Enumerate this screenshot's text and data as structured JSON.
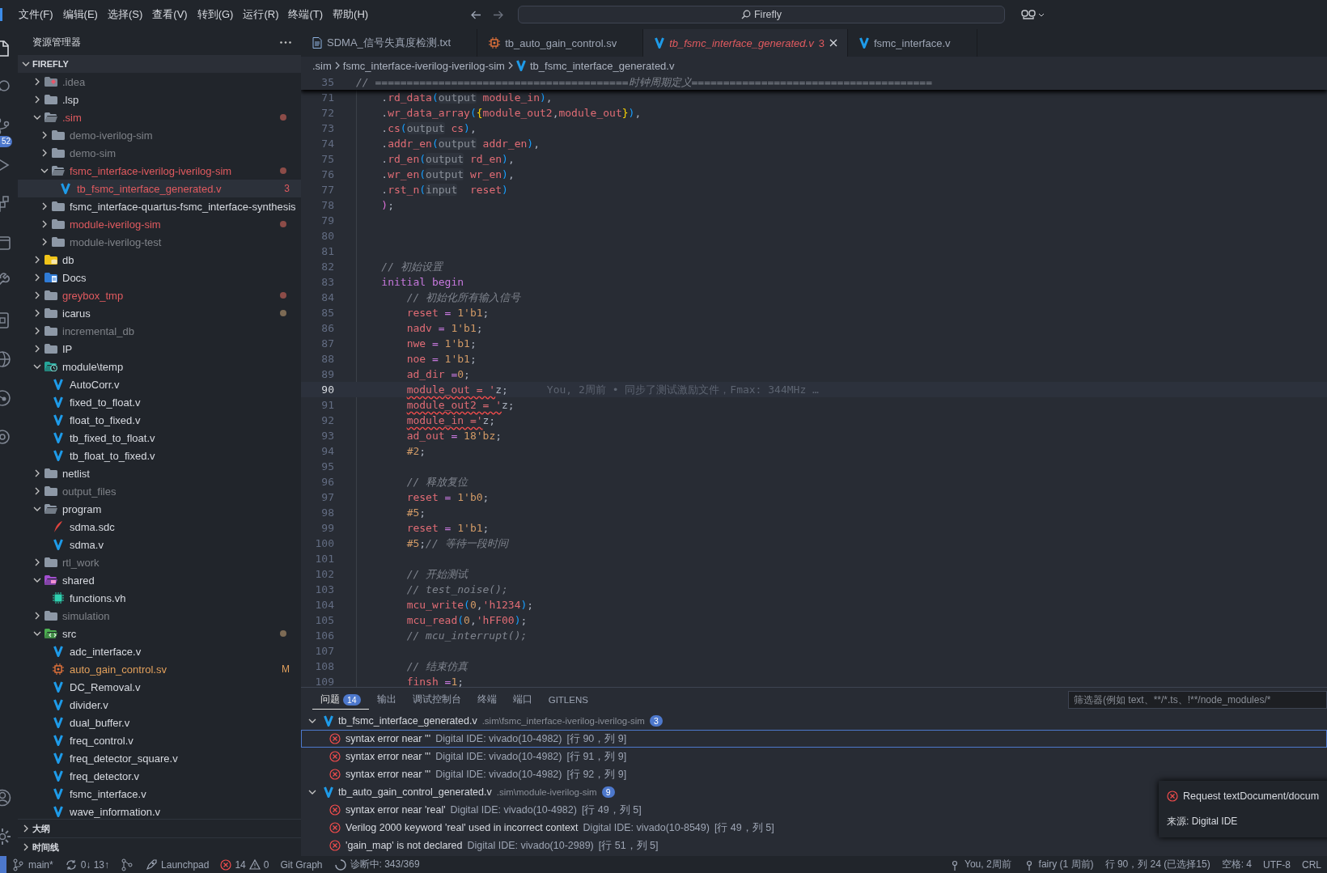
{
  "title_bar": {
    "menus": [
      "文件(F)",
      "编辑(E)",
      "选择(S)",
      "查看(V)",
      "转到(G)",
      "运行(R)",
      "终端(T)",
      "帮助(H)"
    ],
    "search": "Firefly"
  },
  "activity_bar": {
    "items": [
      {
        "kind": "explorer",
        "selected": true
      },
      {
        "kind": "search",
        "selected": false
      },
      {
        "kind": "source-control",
        "selected": false,
        "badge": "52"
      },
      {
        "kind": "run",
        "selected": false
      },
      {
        "kind": "extensions",
        "selected": false
      },
      {
        "kind": "window",
        "selected": false
      },
      {
        "kind": "tools",
        "selected": false
      },
      {
        "kind": "device",
        "selected": false
      },
      {
        "kind": "globe",
        "selected": false
      },
      {
        "kind": "graph",
        "selected": false
      },
      {
        "kind": "box",
        "selected": false
      }
    ],
    "bottom": [
      {
        "kind": "account",
        "selected": false
      },
      {
        "kind": "settings",
        "selected": false
      }
    ]
  },
  "explorer": {
    "title": "资源管理器",
    "root": "FIREFLY",
    "root_expanded": true,
    "tree": [
      {
        "name": ".idea",
        "kind": "idea",
        "ignored": true,
        "errors": false,
        "modified": false,
        "expanded": false,
        "selected": false
      },
      {
        "name": ".lsp",
        "kind": "folder",
        "ignored": false,
        "errors": false,
        "modified": false,
        "expanded": false,
        "selected": false
      },
      {
        "name": ".sim",
        "kind": "folder",
        "ignored": false,
        "errors": true,
        "modified": false,
        "expanded": true,
        "selected": false,
        "color": "#8c4c48",
        "children": [
          {
            "name": "demo-iverilog-sim",
            "kind": "folder",
            "ignored": true,
            "errors": false,
            "modified": false,
            "expanded": false,
            "selected": false
          },
          {
            "name": "demo-sim",
            "kind": "folder",
            "ignored": true,
            "errors": false,
            "modified": false,
            "expanded": false,
            "selected": false
          },
          {
            "name": "fsmc_interface-iverilog-iverilog-sim",
            "kind": "folder",
            "ignored": false,
            "errors": true,
            "modified": false,
            "expanded": true,
            "selected": false,
            "color": "#8c4c48",
            "children": [
              {
                "name": "tb_fsmc_interface_generated.v",
                "kind": "verilog",
                "ignored": false,
                "errors": true,
                "modified": false,
                "selected": true,
                "badge": "3"
              }
            ]
          },
          {
            "name": "fsmc_interface-quartus-fsmc_interface-synthesis",
            "kind": "folder",
            "ignored": false,
            "errors": false,
            "modified": false,
            "expanded": false,
            "selected": false
          },
          {
            "name": "module-iverilog-sim",
            "kind": "folder",
            "ignored": false,
            "errors": true,
            "modified": false,
            "expanded": false,
            "selected": false,
            "color": "#8c4c48"
          },
          {
            "name": "module-iverilog-test",
            "kind": "folder",
            "ignored": true,
            "errors": false,
            "modified": false,
            "expanded": false,
            "selected": false
          }
        ]
      },
      {
        "name": "db",
        "kind": "db",
        "ignored": false,
        "errors": false,
        "modified": false,
        "expanded": false,
        "selected": false
      },
      {
        "name": "Docs",
        "kind": "docs",
        "ignored": false,
        "errors": false,
        "modified": false,
        "expanded": false,
        "selected": false
      },
      {
        "name": "greybox_tmp",
        "kind": "folder",
        "ignored": false,
        "errors": true,
        "modified": false,
        "expanded": false,
        "selected": false,
        "color": "#8c4c48"
      },
      {
        "name": "icarus",
        "kind": "folder",
        "ignored": false,
        "errors": false,
        "modified": false,
        "expanded": false,
        "selected": false,
        "color": "#7d6b55"
      },
      {
        "name": "incremental_db",
        "kind": "folder",
        "ignored": true,
        "errors": false,
        "modified": false,
        "expanded": false,
        "selected": false
      },
      {
        "name": "IP",
        "kind": "folder",
        "ignored": false,
        "errors": false,
        "modified": false,
        "expanded": false,
        "selected": false
      },
      {
        "name": "module\\temp",
        "kind": "clock",
        "ignored": false,
        "errors": false,
        "modified": false,
        "expanded": true,
        "selected": false,
        "children": [
          {
            "name": "AutoCorr.v",
            "kind": "verilog",
            "ignored": false,
            "errors": false,
            "modified": false,
            "selected": false
          },
          {
            "name": "fixed_to_float.v",
            "kind": "verilog",
            "ignored": false,
            "errors": false,
            "modified": false,
            "selected": false
          },
          {
            "name": "float_to_fixed.v",
            "kind": "verilog",
            "ignored": false,
            "errors": false,
            "modified": false,
            "selected": false
          },
          {
            "name": "tb_fixed_to_float.v",
            "kind": "verilog",
            "ignored": false,
            "errors": false,
            "modified": false,
            "selected": false
          },
          {
            "name": "tb_float_to_fixed.v",
            "kind": "verilog",
            "ignored": false,
            "errors": false,
            "modified": false,
            "selected": false
          }
        ]
      },
      {
        "name": "netlist",
        "kind": "folder",
        "ignored": false,
        "errors": false,
        "modified": false,
        "expanded": false,
        "selected": false
      },
      {
        "name": "output_files",
        "kind": "folder",
        "ignored": true,
        "errors": false,
        "modified": false,
        "expanded": false,
        "selected": false
      },
      {
        "name": "program",
        "kind": "folder",
        "ignored": false,
        "errors": false,
        "modified": false,
        "expanded": true,
        "selected": false,
        "children": [
          {
            "name": "sdma.sdc",
            "kind": "sdc",
            "ignored": false,
            "errors": false,
            "modified": false,
            "selected": false
          },
          {
            "name": "sdma.v",
            "kind": "verilog",
            "ignored": false,
            "errors": false,
            "modified": false,
            "selected": false
          }
        ]
      },
      {
        "name": "rtl_work",
        "kind": "folder",
        "ignored": true,
        "errors": false,
        "modified": false,
        "expanded": false,
        "selected": false
      },
      {
        "name": "shared",
        "kind": "shared",
        "ignored": false,
        "errors": false,
        "modified": false,
        "expanded": true,
        "selected": false,
        "children": [
          {
            "name": "functions.vh",
            "kind": "vh",
            "ignored": false,
            "errors": false,
            "modified": false,
            "selected": false
          }
        ]
      },
      {
        "name": "simulation",
        "kind": "folder",
        "ignored": true,
        "errors": false,
        "modified": false,
        "expanded": false,
        "selected": false
      },
      {
        "name": "src",
        "kind": "src",
        "ignored": false,
        "errors": false,
        "modified": false,
        "expanded": true,
        "selected": false,
        "color": "#7d6b55",
        "children": [
          {
            "name": "adc_interface.v",
            "kind": "verilog",
            "ignored": false,
            "errors": false,
            "modified": false,
            "selected": false
          },
          {
            "name": "auto_gain_control.sv",
            "kind": "sv",
            "ignored": false,
            "errors": false,
            "modified": true,
            "selected": false,
            "badge": "M"
          },
          {
            "name": "DC_Removal.v",
            "kind": "verilog",
            "ignored": false,
            "errors": false,
            "modified": false,
            "selected": false
          },
          {
            "name": "divider.v",
            "kind": "verilog",
            "ignored": false,
            "errors": false,
            "modified": false,
            "selected": false
          },
          {
            "name": "dual_buffer.v",
            "kind": "verilog",
            "ignored": false,
            "errors": false,
            "modified": false,
            "selected": false
          },
          {
            "name": "freq_control.v",
            "kind": "verilog",
            "ignored": false,
            "errors": false,
            "modified": false,
            "selected": false
          },
          {
            "name": "freq_detector_square.v",
            "kind": "verilog",
            "ignored": false,
            "errors": false,
            "modified": false,
            "selected": false
          },
          {
            "name": "freq_detector.v",
            "kind": "verilog",
            "ignored": false,
            "errors": false,
            "modified": false,
            "selected": false
          },
          {
            "name": "fsmc_interface.v",
            "kind": "verilog",
            "ignored": false,
            "errors": false,
            "modified": false,
            "selected": false
          },
          {
            "name": "wave_information.v",
            "kind": "verilog",
            "ignored": false,
            "errors": false,
            "modified": false,
            "selected": false
          }
        ]
      }
    ],
    "sections": [
      {
        "label": "大纲",
        "expanded": false
      },
      {
        "label": "时间线",
        "expanded": false
      }
    ]
  },
  "tabs": [
    {
      "label": "SDMA_信号失真度检测.txt",
      "kind": "txt",
      "selected": false,
      "preview": false,
      "errors": false
    },
    {
      "label": "tb_auto_gain_control.sv",
      "kind": "sv",
      "selected": false,
      "preview": false,
      "errors": false
    },
    {
      "label": "tb_fsmc_interface_generated.v",
      "kind": "verilog",
      "selected": true,
      "preview": true,
      "errors": true,
      "problems": "3"
    },
    {
      "label": "fsmc_interface.v",
      "kind": "verilog",
      "selected": false,
      "preview": false,
      "errors": false
    }
  ],
  "breadcrumbs": [
    {
      "label": ".sim",
      "kind": "folder"
    },
    {
      "label": "fsmc_interface-iverilog-iverilog-sim",
      "kind": "folder"
    },
    {
      "label": "tb_fsmc_interface_generated.v",
      "kind": "verilog"
    }
  ],
  "editor": {
    "sticky": {
      "number": "35",
      "tokens": [
        {
          "kind": "com",
          "text": "// ========================================时钟周期定义======================================"
        }
      ]
    },
    "lines": [
      {
        "number": "71",
        "current": false,
        "tokens": [
          {
            "kind": "p",
            "text": "    ."
          },
          {
            "kind": "id",
            "text": "rd_data"
          },
          {
            "kind": "b3",
            "text": "("
          },
          {
            "kind": "hint",
            "text": "output"
          },
          {
            "kind": "id",
            "text": " module_in"
          },
          {
            "kind": "b3",
            "text": ")"
          },
          {
            "kind": "p",
            "text": ","
          }
        ]
      },
      {
        "number": "72",
        "current": false,
        "tokens": [
          {
            "kind": "p",
            "text": "    ."
          },
          {
            "kind": "id",
            "text": "wr_data_array"
          },
          {
            "kind": "b3",
            "text": "("
          },
          {
            "kind": "b1",
            "text": "{"
          },
          {
            "kind": "id",
            "text": "module_out2"
          },
          {
            "kind": "p",
            "text": ","
          },
          {
            "kind": "id",
            "text": "module_out"
          },
          {
            "kind": "b1",
            "text": "}"
          },
          {
            "kind": "b3",
            "text": ")"
          },
          {
            "kind": "p",
            "text": ","
          }
        ]
      },
      {
        "number": "73",
        "current": false,
        "tokens": [
          {
            "kind": "p",
            "text": "    ."
          },
          {
            "kind": "id",
            "text": "cs"
          },
          {
            "kind": "b3",
            "text": "("
          },
          {
            "kind": "hint",
            "text": "output"
          },
          {
            "kind": "id",
            "text": " cs"
          },
          {
            "kind": "b3",
            "text": ")"
          },
          {
            "kind": "p",
            "text": ","
          }
        ]
      },
      {
        "number": "74",
        "current": false,
        "tokens": [
          {
            "kind": "p",
            "text": "    ."
          },
          {
            "kind": "id",
            "text": "addr_en"
          },
          {
            "kind": "b3",
            "text": "("
          },
          {
            "kind": "hint",
            "text": "output"
          },
          {
            "kind": "id",
            "text": " addr_en"
          },
          {
            "kind": "b3",
            "text": ")"
          },
          {
            "kind": "p",
            "text": ","
          }
        ]
      },
      {
        "number": "75",
        "current": false,
        "tokens": [
          {
            "kind": "p",
            "text": "    ."
          },
          {
            "kind": "id",
            "text": "rd_en"
          },
          {
            "kind": "b3",
            "text": "("
          },
          {
            "kind": "hint",
            "text": "output"
          },
          {
            "kind": "id",
            "text": " rd_en"
          },
          {
            "kind": "b3",
            "text": ")"
          },
          {
            "kind": "p",
            "text": ","
          }
        ]
      },
      {
        "number": "76",
        "current": false,
        "tokens": [
          {
            "kind": "p",
            "text": "    ."
          },
          {
            "kind": "id",
            "text": "wr_en"
          },
          {
            "kind": "b3",
            "text": "("
          },
          {
            "kind": "hint",
            "text": "output"
          },
          {
            "kind": "id",
            "text": " wr_en"
          },
          {
            "kind": "b3",
            "text": ")"
          },
          {
            "kind": "p",
            "text": ","
          }
        ]
      },
      {
        "number": "77",
        "current": false,
        "tokens": [
          {
            "kind": "p",
            "text": "    ."
          },
          {
            "kind": "id",
            "text": "rst_n"
          },
          {
            "kind": "b3",
            "text": "("
          },
          {
            "kind": "hint",
            "text": "input"
          },
          {
            "kind": "id",
            "text": "  reset"
          },
          {
            "kind": "b3",
            "text": ")"
          }
        ]
      },
      {
        "number": "78",
        "current": false,
        "tokens": [
          {
            "kind": "b2",
            "text": "    )"
          },
          {
            "kind": "p",
            "text": ";"
          }
        ]
      },
      {
        "number": "79",
        "current": false
      },
      {
        "number": "80",
        "current": false
      },
      {
        "number": "81",
        "current": false
      },
      {
        "number": "82",
        "current": false,
        "tokens": [
          {
            "kind": "com",
            "text": "    // 初始设置"
          }
        ]
      },
      {
        "number": "83",
        "current": false,
        "tokens": [
          {
            "kind": "kw",
            "text": "    initial begin"
          }
        ]
      },
      {
        "number": "84",
        "current": false,
        "tokens": [
          {
            "kind": "com",
            "text": "        // 初始化所有输入信号"
          }
        ]
      },
      {
        "number": "85",
        "current": false,
        "tokens": [
          {
            "kind": "id",
            "text": "        reset"
          },
          {
            "kind": "op",
            "text": " = "
          },
          {
            "kind": "num",
            "text": "1'b1"
          },
          {
            "kind": "p",
            "text": ";"
          }
        ]
      },
      {
        "number": "86",
        "current": false,
        "tokens": [
          {
            "kind": "id",
            "text": "        nadv"
          },
          {
            "kind": "op",
            "text": " = "
          },
          {
            "kind": "num",
            "text": "1'b1"
          },
          {
            "kind": "p",
            "text": ";"
          }
        ]
      },
      {
        "number": "87",
        "current": false,
        "tokens": [
          {
            "kind": "id",
            "text": "        nwe"
          },
          {
            "kind": "op",
            "text": " = "
          },
          {
            "kind": "num",
            "text": "1'b1"
          },
          {
            "kind": "p",
            "text": ";"
          }
        ]
      },
      {
        "number": "88",
        "current": false,
        "tokens": [
          {
            "kind": "id",
            "text": "        noe"
          },
          {
            "kind": "op",
            "text": " = "
          },
          {
            "kind": "num",
            "text": "1'b1"
          },
          {
            "kind": "p",
            "text": ";"
          }
        ]
      },
      {
        "number": "89",
        "current": false,
        "tokens": [
          {
            "kind": "id",
            "text": "        ad_dir"
          },
          {
            "kind": "op",
            "text": " ="
          },
          {
            "kind": "num",
            "text": "0"
          },
          {
            "kind": "p",
            "text": ";"
          }
        ]
      },
      {
        "number": "90",
        "current": true,
        "tokens": [
          {
            "kind": "err",
            "text": "        module_out = '"
          },
          {
            "kind": "p",
            "text": "z;"
          }
        ],
        "blame": "You, 2周前 • 同步了测试激励文件，Fmax: 344MHz …"
      },
      {
        "number": "91",
        "current": false,
        "tokens": [
          {
            "kind": "err",
            "text": "        module_out2 = '"
          },
          {
            "kind": "p",
            "text": "z;"
          }
        ]
      },
      {
        "number": "92",
        "current": false,
        "tokens": [
          {
            "kind": "err",
            "text": "        module_in ='"
          },
          {
            "kind": "p",
            "text": "z;"
          }
        ]
      },
      {
        "number": "93",
        "current": false,
        "tokens": [
          {
            "kind": "id",
            "text": "        ad_out"
          },
          {
            "kind": "op",
            "text": " = "
          },
          {
            "kind": "num",
            "text": "18'bz"
          },
          {
            "kind": "p",
            "text": ";"
          }
        ]
      },
      {
        "number": "94",
        "current": false,
        "tokens": [
          {
            "kind": "num",
            "text": "        #2"
          },
          {
            "kind": "p",
            "text": ";"
          }
        ]
      },
      {
        "number": "95",
        "current": false
      },
      {
        "number": "96",
        "current": false,
        "tokens": [
          {
            "kind": "com",
            "text": "        // 释放复位"
          }
        ]
      },
      {
        "number": "97",
        "current": false,
        "tokens": [
          {
            "kind": "id",
            "text": "        reset"
          },
          {
            "kind": "op",
            "text": " = "
          },
          {
            "kind": "num",
            "text": "1'b0"
          },
          {
            "kind": "p",
            "text": ";"
          }
        ]
      },
      {
        "number": "98",
        "current": false,
        "tokens": [
          {
            "kind": "num",
            "text": "        #5"
          },
          {
            "kind": "p",
            "text": ";"
          }
        ]
      },
      {
        "number": "99",
        "current": false,
        "tokens": [
          {
            "kind": "id",
            "text": "        reset"
          },
          {
            "kind": "op",
            "text": " = "
          },
          {
            "kind": "num",
            "text": "1'b1"
          },
          {
            "kind": "p",
            "text": ";"
          }
        ]
      },
      {
        "number": "100",
        "current": false,
        "tokens": [
          {
            "kind": "num",
            "text": "        #5"
          },
          {
            "kind": "p",
            "text": ";"
          },
          {
            "kind": "com",
            "text": "// 等待一段时间"
          }
        ]
      },
      {
        "number": "101",
        "current": false
      },
      {
        "number": "102",
        "current": false,
        "tokens": [
          {
            "kind": "com",
            "text": "        // 开始测试"
          }
        ]
      },
      {
        "number": "103",
        "current": false,
        "tokens": [
          {
            "kind": "com",
            "text": "        // test_noise();"
          }
        ]
      },
      {
        "number": "104",
        "current": false,
        "tokens": [
          {
            "kind": "id",
            "text": "        mcu_write"
          },
          {
            "kind": "b3",
            "text": "("
          },
          {
            "kind": "num",
            "text": "0"
          },
          {
            "kind": "p",
            "text": ","
          },
          {
            "kind": "id",
            "text": "'h1234"
          },
          {
            "kind": "b3",
            "text": ")"
          },
          {
            "kind": "p",
            "text": ";"
          }
        ]
      },
      {
        "number": "105",
        "current": false,
        "tokens": [
          {
            "kind": "id",
            "text": "        mcu_read"
          },
          {
            "kind": "b3",
            "text": "("
          },
          {
            "kind": "num",
            "text": "0"
          },
          {
            "kind": "p",
            "text": ","
          },
          {
            "kind": "id",
            "text": "'hFF00"
          },
          {
            "kind": "b3",
            "text": ")"
          },
          {
            "kind": "p",
            "text": ";"
          }
        ]
      },
      {
        "number": "106",
        "current": false,
        "tokens": [
          {
            "kind": "com",
            "text": "        // mcu_interrupt();"
          }
        ]
      },
      {
        "number": "107",
        "current": false
      },
      {
        "number": "108",
        "current": false,
        "tokens": [
          {
            "kind": "com",
            "text": "        // 结束仿真"
          }
        ]
      },
      {
        "number": "109",
        "current": false,
        "tokens": [
          {
            "kind": "id",
            "text": "        finsh"
          },
          {
            "kind": "op",
            "text": " ="
          },
          {
            "kind": "num",
            "text": "1"
          },
          {
            "kind": "p",
            "text": ";"
          }
        ]
      }
    ]
  },
  "panel": {
    "tabs": [
      {
        "label": "问题",
        "selected": true,
        "badge": "14"
      },
      {
        "label": "输出",
        "selected": false
      },
      {
        "label": "调试控制台",
        "selected": false
      },
      {
        "label": "终端",
        "selected": false
      },
      {
        "label": "端口",
        "selected": false
      },
      {
        "label": "GITLENS",
        "selected": false
      }
    ],
    "filter_placeholder": "筛选器(例如 text、**/*.ts、!**/node_modules/*",
    "groups": [
      {
        "file": "tb_fsmc_interface_generated.v",
        "path": ".sim\\fsmc_interface-iverilog-iverilog-sim",
        "count": "3",
        "expanded": true,
        "items": [
          {
            "message": "syntax error near '''",
            "source": "Digital IDE: vivado(10-4982)",
            "location": "[行 90，列 9]",
            "selected": true
          },
          {
            "message": "syntax error near '''",
            "source": "Digital IDE: vivado(10-4982)",
            "location": "[行 91，列 9]",
            "selected": false
          },
          {
            "message": "syntax error near '''",
            "source": "Digital IDE: vivado(10-4982)",
            "location": "[行 92，列 9]",
            "selected": false
          }
        ]
      },
      {
        "file": "tb_auto_gain_control_generated.v",
        "path": ".sim\\module-iverilog-sim",
        "count": "9",
        "expanded": true,
        "items": [
          {
            "message": "syntax error near 'real'",
            "source": "Digital IDE: vivado(10-4982)",
            "location": "[行 49，列 5]",
            "selected": false
          },
          {
            "message": "Verilog 2000 keyword 'real' used in incorrect context",
            "source": "Digital IDE: vivado(10-8549)",
            "location": "[行 49，列 5]",
            "selected": false
          },
          {
            "message": "'gain_map' is not declared",
            "source": "Digital IDE: vivado(10-2989)",
            "location": "[行 51，列 5]",
            "selected": false
          }
        ]
      }
    ]
  },
  "notification": {
    "title": "Request textDocument/docum",
    "source": "来源: Digital IDE"
  },
  "status_bar": {
    "left": [
      {
        "kind": "branch",
        "text": "main*"
      },
      {
        "kind": "sync",
        "text": "0↓ 13↑"
      },
      {
        "kind": "graph"
      },
      {
        "kind": "launchpad",
        "text": "Launchpad"
      },
      {
        "kind": "problems",
        "errors": "14",
        "warnings": "0"
      },
      {
        "kind": "plain",
        "text": "Git Graph"
      },
      {
        "kind": "progress",
        "text": "诊断中: 343/369"
      }
    ],
    "right": [
      {
        "kind": "blame",
        "text": "You, 2周前"
      },
      {
        "kind": "blame",
        "text": "fairy (1 周前)"
      },
      {
        "kind": "plain",
        "text": "行 90，列 24 (已选择15)"
      },
      {
        "kind": "plain",
        "text": "空格: 4"
      },
      {
        "kind": "plain",
        "text": "UTF-8"
      },
      {
        "kind": "plain",
        "text": "CRL"
      }
    ]
  }
}
